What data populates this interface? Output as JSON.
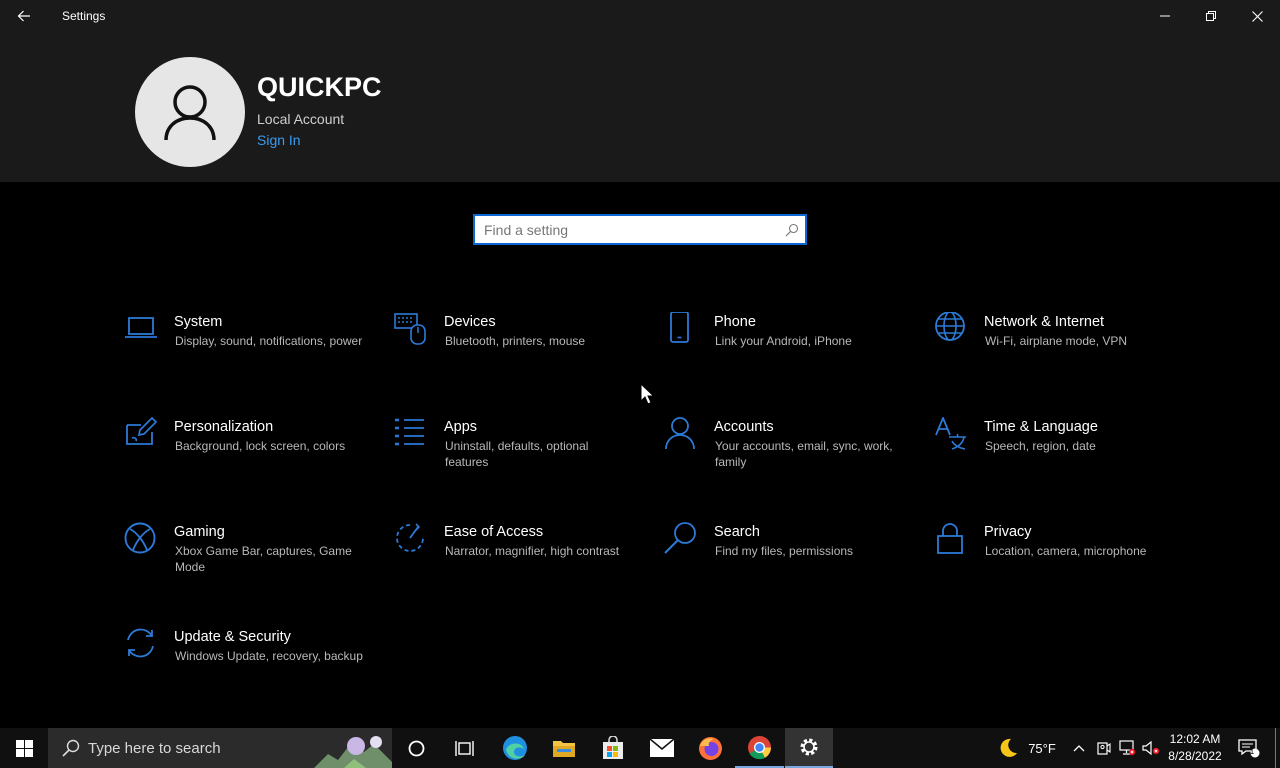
{
  "window": {
    "title": "Settings"
  },
  "account": {
    "name": "QUICKPC",
    "type": "Local Account",
    "sign_in_label": "Sign In"
  },
  "search": {
    "placeholder": "Find a setting"
  },
  "accent_color": "#0a67d4",
  "categories": [
    {
      "name": "System",
      "description": "Display, sound, notifications, power",
      "icon": "laptop-icon"
    },
    {
      "name": "Devices",
      "description": "Bluetooth, printers, mouse",
      "icon": "devices-icon"
    },
    {
      "name": "Phone",
      "description": "Link your Android, iPhone",
      "icon": "phone-icon"
    },
    {
      "name": "Network & Internet",
      "description": "Wi-Fi, airplane mode, VPN",
      "icon": "globe-icon"
    },
    {
      "name": "Personalization",
      "description": "Background, lock screen, colors",
      "icon": "paint-icon"
    },
    {
      "name": "Apps",
      "description": "Uninstall, defaults, optional features",
      "icon": "apps-list-icon"
    },
    {
      "name": "Accounts",
      "description": "Your accounts, email, sync, work, family",
      "icon": "person-icon"
    },
    {
      "name": "Time & Language",
      "description": "Speech, region, date",
      "icon": "time-language-icon"
    },
    {
      "name": "Gaming",
      "description": "Xbox Game Bar, captures, Game Mode",
      "icon": "xbox-icon"
    },
    {
      "name": "Ease of Access",
      "description": "Narrator, magnifier, high contrast",
      "icon": "ease-of-access-icon"
    },
    {
      "name": "Search",
      "description": "Find my files, permissions",
      "icon": "magnifier-icon"
    },
    {
      "name": "Privacy",
      "description": "Location, camera, microphone",
      "icon": "lock-icon"
    },
    {
      "name": "Update & Security",
      "description": "Windows Update, recovery, backup",
      "icon": "sync-icon"
    }
  ],
  "taskbar": {
    "search_placeholder": "Type here to search",
    "weather": "75°F",
    "time": "12:02 AM",
    "date": "8/28/2022",
    "notification_count": "1"
  }
}
